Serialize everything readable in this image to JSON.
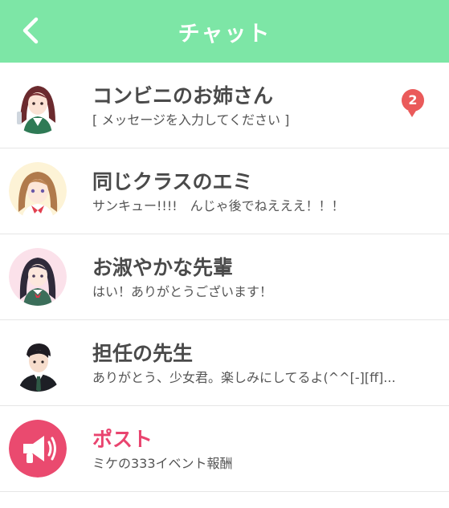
{
  "theme": {
    "accent": "#7de6a6",
    "badge": "#ea5a5a",
    "post_color": "#e9446f"
  },
  "header": {
    "title": "チャット",
    "back_icon": "chevron-left-icon"
  },
  "chats": [
    {
      "name": "コンビニのお姉さん",
      "preview": "[ メッセージを入力してください ]",
      "unread": "2"
    },
    {
      "name": "同じクラスのエミ",
      "preview": "サンキュー!!!!　んじゃ後でねえええ！！！"
    },
    {
      "name": "お淑やかな先輩",
      "preview": "はい！ありがとうございます！"
    },
    {
      "name": "担任の先生",
      "preview": "ありがとう、少女君。楽しみにしてるよ(^^[-][ff]..."
    },
    {
      "name": "ポスト",
      "preview": "ミケの333イベント報酬",
      "icon": "megaphone-icon"
    }
  ]
}
